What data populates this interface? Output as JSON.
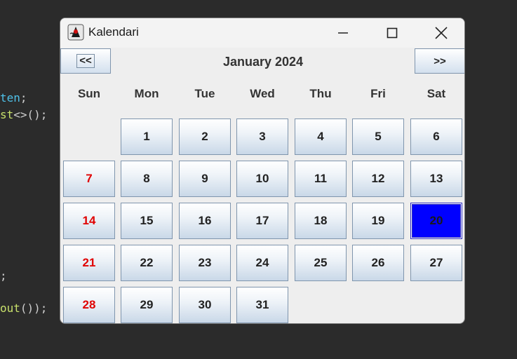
{
  "editor": {
    "lines": [
      {
        "parts": [
          {
            "text": "ten",
            "cls": "t1"
          },
          {
            "text": ";",
            "cls": "t3"
          }
        ]
      },
      {
        "parts": [
          {
            "text": "st",
            "cls": "t2"
          },
          {
            "text": "<>();",
            "cls": "t3"
          }
        ]
      },
      {
        "parts": [
          {
            "text": ";",
            "cls": "t3"
          }
        ]
      },
      {
        "parts": [
          {
            "text": "out",
            "cls": "t2"
          },
          {
            "text": "());",
            "cls": "t3"
          }
        ]
      }
    ]
  },
  "window": {
    "title": "Kalendari",
    "icon": "java-duke-icon",
    "controls": {
      "minimize": "minimize-icon",
      "maximize": "maximize-icon",
      "close": "close-icon"
    }
  },
  "calendar": {
    "prev_label": "<<",
    "next_label": ">>",
    "month_label": "January 2024",
    "weekdays": [
      "Sun",
      "Mon",
      "Tue",
      "Wed",
      "Thu",
      "Fri",
      "Sat"
    ],
    "weeks": [
      [
        "",
        "1",
        "2",
        "3",
        "4",
        "5",
        "6"
      ],
      [
        "7",
        "8",
        "9",
        "10",
        "11",
        "12",
        "13"
      ],
      [
        "14",
        "15",
        "16",
        "17",
        "18",
        "19",
        "20"
      ],
      [
        "21",
        "22",
        "23",
        "24",
        "25",
        "26",
        "27"
      ],
      [
        "28",
        "29",
        "30",
        "31",
        "",
        "",
        ""
      ]
    ],
    "selected_day": "20",
    "colors": {
      "sunday": "#e00000",
      "selected": "#0000ff"
    }
  }
}
